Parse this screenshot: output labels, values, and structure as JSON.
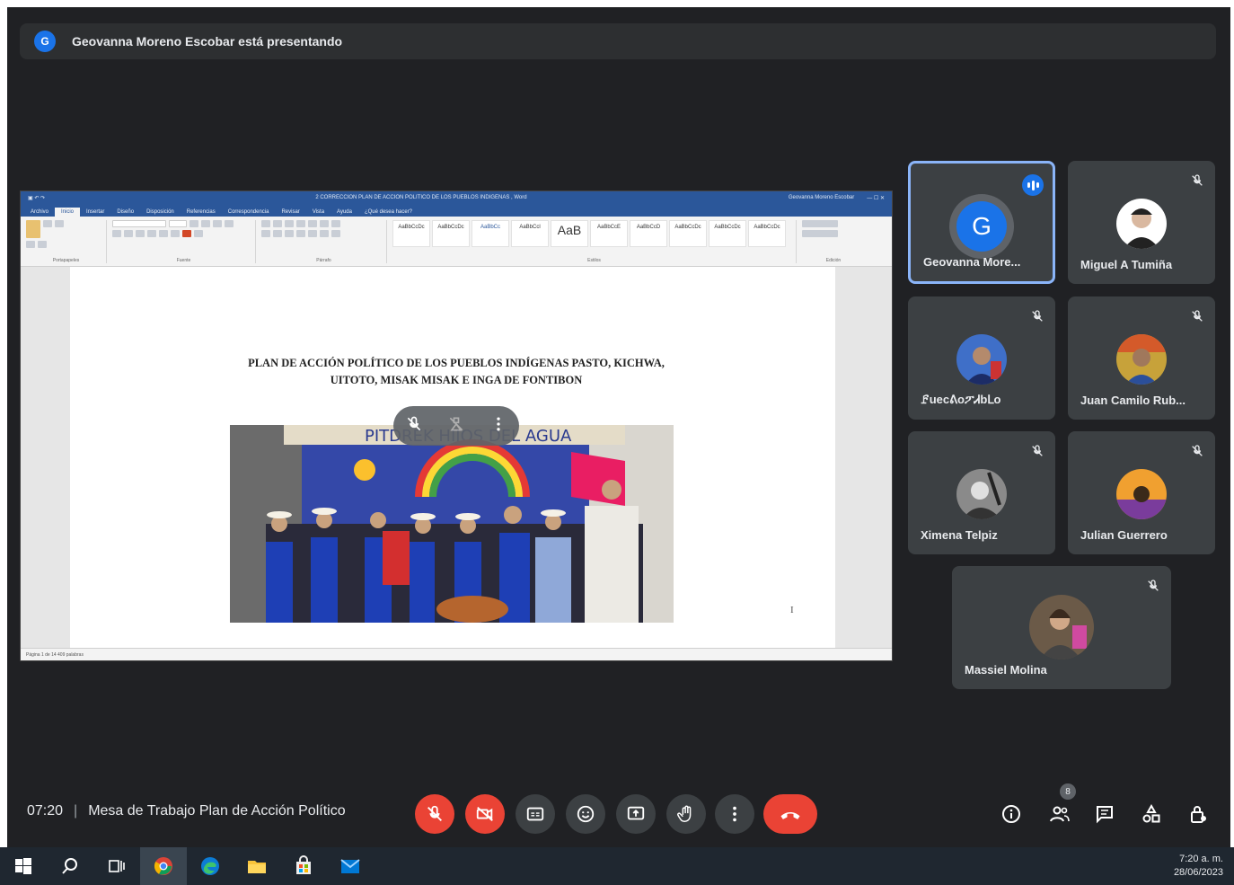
{
  "banner": {
    "avatar_initial": "G",
    "text": "Geovanna Moreno Escobar está presentando"
  },
  "word": {
    "title_bar": "2 CORRECCION PLAN DE ACCION POLITICO DE LOS PUEBLOS INDIGENAS  ,  Word",
    "user": "Geovanna Moreno Escobar",
    "tabs": [
      "Archivo",
      "Inicio",
      "Insertar",
      "Diseño",
      "Disposición",
      "Referencias",
      "Correspondencia",
      "Revisar",
      "Vista",
      "Ayuda",
      "¿Qué desea hacer?"
    ],
    "active_tab": "Inicio",
    "ribbon_groups": [
      "Portapapeles",
      "Fuente",
      "Párrafo",
      "Estilos",
      "Edición"
    ],
    "styles": [
      "AaBbCcDc",
      "AaBbCcDc",
      "AaBbCc",
      "AaBbCcl",
      "AaB",
      "AaBbCcE",
      "AaBbCcD",
      "AaBbCcDc",
      "AaBbCcDc",
      "AaBbCcDc"
    ],
    "style_big": "AaB",
    "doc_title_line1": "PLAN DE ACCIÓN POLÍTICO DE LOS PUEBLOS INDÍGENAS PASTO, KICHWA,",
    "doc_title_line2": "UITOTO, MISAK MISAK E INGA DE FONTIBON",
    "photo_banner": "PITDREK  HIJOS DEL AGUA",
    "status_left": "Página 1 de 14     409 palabras",
    "cursor_glyph": "I"
  },
  "participants": [
    {
      "name": "Geovanna More...",
      "initial": "G",
      "speaking": true,
      "muted": false
    },
    {
      "name": "Miguel A Tumiña",
      "muted": true
    },
    {
      "name": "ꗓuecᕕoፖᏗbᒪo",
      "muted": true
    },
    {
      "name": "Juan Camilo Rub...",
      "muted": true
    },
    {
      "name": "Ximena Telpiz",
      "muted": true
    },
    {
      "name": "Julian Guerrero",
      "muted": true
    },
    {
      "name": "Massiel Molina",
      "muted": true
    }
  ],
  "bottom": {
    "time": "07:20",
    "meeting_title": "Mesa de Trabajo Plan de Acción Político",
    "participant_count": "8"
  },
  "taskbar": {
    "clock_time": "7:20 a. m.",
    "clock_date": "28/06/2023"
  },
  "colors": {
    "meet_bg": "#202124",
    "tile_bg": "#3c4043",
    "danger": "#ea4335",
    "accent": "#1a73e8",
    "active_border": "#8ab4f8"
  }
}
